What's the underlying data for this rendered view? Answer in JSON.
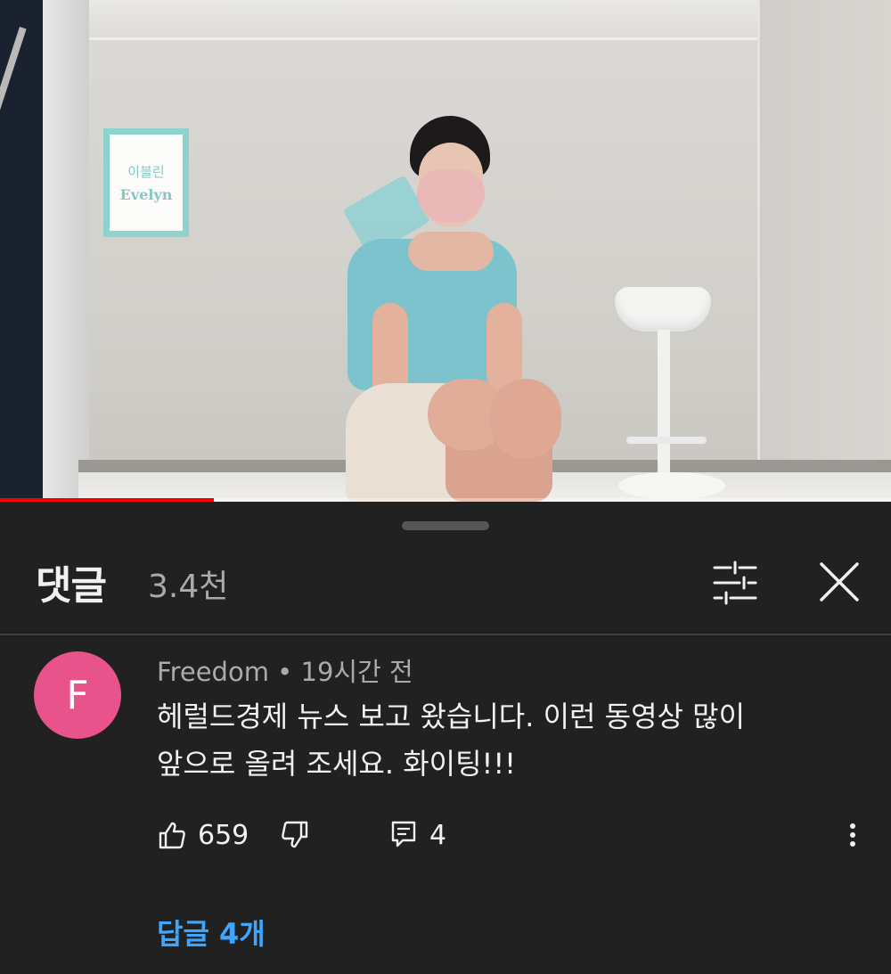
{
  "video": {
    "sign_text_korean": "이블린",
    "sign_text_english": "Evelyn",
    "progress_fraction": 0.24,
    "progress_color": "#ff0000"
  },
  "comments_panel": {
    "title": "댓글",
    "count": "3.4천",
    "filter_icon": "sliders-icon",
    "close_icon": "close-icon"
  },
  "comment": {
    "avatar_letter": "F",
    "avatar_color": "#e8538b",
    "author": "Freedom",
    "separator": " • ",
    "time": "19시간 전",
    "text_line1": "헤럴드경제 뉴스 보고 왔습니다. 이런 동영상 많이",
    "text_line2": "앞으로 올려 조세요. 화이팅!!!",
    "likes": "659",
    "reply_count": "4",
    "replies_link": "답글 4개"
  },
  "colors": {
    "background": "#212121",
    "link": "#3ea6ff",
    "secondary_text": "#aaaaaa",
    "primary_text": "#f1f1f1"
  }
}
